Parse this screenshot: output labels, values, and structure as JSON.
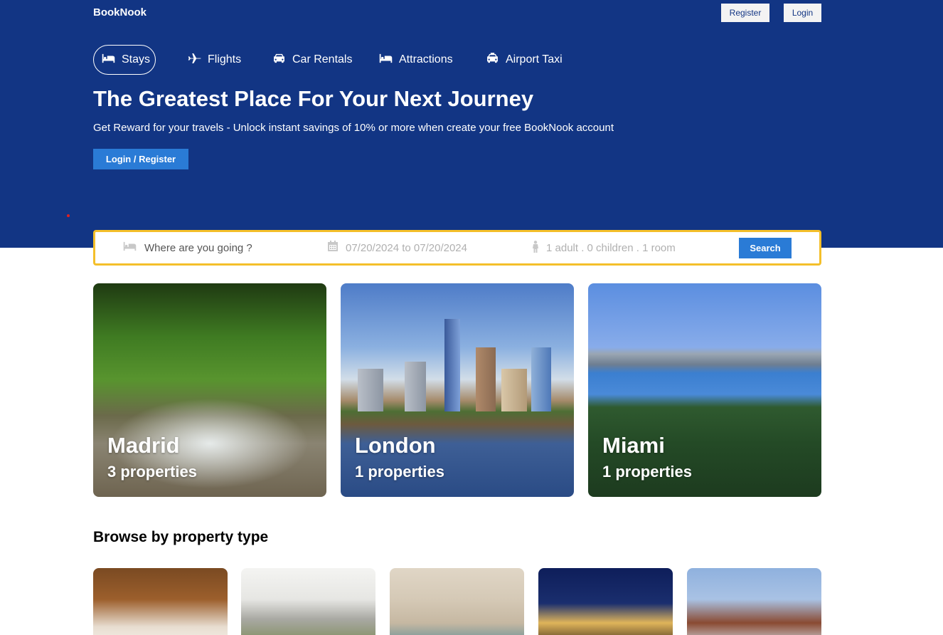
{
  "header": {
    "brand": "BookNook",
    "register_label": "Register",
    "login_label": "Login"
  },
  "nav": [
    {
      "label": "Stays",
      "icon": "bed-icon",
      "active": true
    },
    {
      "label": "Flights",
      "icon": "plane-icon",
      "active": false
    },
    {
      "label": "Car Rentals",
      "icon": "car-icon",
      "active": false
    },
    {
      "label": "Attractions",
      "icon": "bed-icon",
      "active": false
    },
    {
      "label": "Airport Taxi",
      "icon": "taxi-icon",
      "active": false
    }
  ],
  "hero": {
    "title": "The Greatest Place For Your Next Journey",
    "subtitle": "Get Reward for your travels - Unlock instant savings of 10% or more when create your free BookNook account",
    "button_label": "Login / Register"
  },
  "search": {
    "destination_placeholder": "Where are you going ?",
    "destination_icon": "bed-icon",
    "dates": "07/20/2024 to 07/20/2024",
    "dates_icon": "calendar-icon",
    "guests": "1 adult . 0 children . 1 room",
    "guests_icon": "person-icon",
    "button_label": "Search"
  },
  "featured": [
    {
      "city": "Madrid",
      "properties": "3 properties"
    },
    {
      "city": "London",
      "properties": "1 properties"
    },
    {
      "city": "Miami",
      "properties": "1 properties"
    }
  ],
  "browse": {
    "title": "Browse by property type"
  },
  "colors": {
    "hero_bg": "#123584",
    "accent_button": "#2a7bd6",
    "search_border": "#f4bf2a"
  }
}
